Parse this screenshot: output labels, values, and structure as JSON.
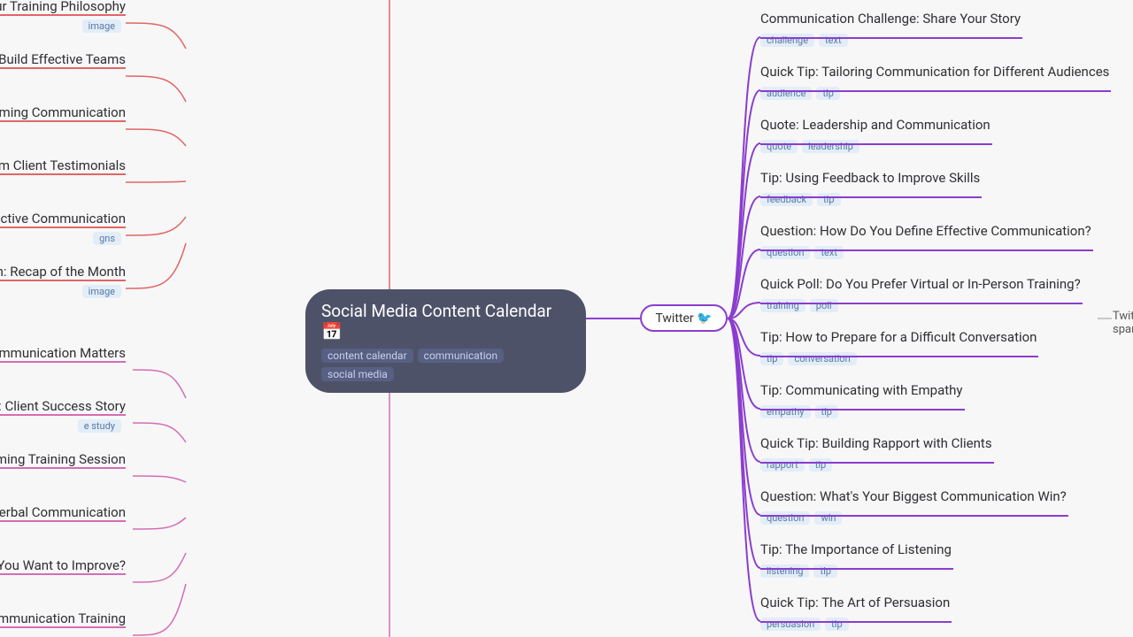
{
  "center": {
    "title": "Social Media Content Calendar 📅",
    "tags": [
      "content calendar",
      "communication",
      "social media"
    ]
  },
  "twitter_label": "Twitter 🐦",
  "right_items": [
    {
      "title": "Communication Challenge: Share Your Story",
      "tags": [
        "challenge",
        "text"
      ]
    },
    {
      "title": "Quick Tip: Tailoring Communication for Different Audiences",
      "tags": [
        "audience",
        "tip"
      ]
    },
    {
      "title": "Quote: Leadership and Communication",
      "tags": [
        "quote",
        "leadership"
      ]
    },
    {
      "title": "Tip: Using Feedback to Improve Skills",
      "tags": [
        "feedback",
        "tip"
      ]
    },
    {
      "title": "Question: How Do You Define Effective Communication?",
      "tags": [
        "question",
        "text"
      ]
    },
    {
      "title": "Quick Poll: Do You Prefer Virtual or In-Person Training?",
      "tags": [
        "training",
        "poll"
      ]
    },
    {
      "title": "Tip: How to Prepare for a Difficult Conversation",
      "tags": [
        "tip",
        "conversation"
      ]
    },
    {
      "title": "Tip: Communicating with Empathy",
      "tags": [
        "empathy",
        "tip"
      ]
    },
    {
      "title": "Quick Tip: Building Rapport with Clients",
      "tags": [
        "rapport",
        "tip"
      ]
    },
    {
      "title": "Question: What's Your Biggest Communication Win?",
      "tags": [
        "question",
        "win"
      ]
    },
    {
      "title": "Tip: The Importance of Listening",
      "tags": [
        "listening",
        "tip"
      ]
    },
    {
      "title": "Quick Tip: The Art of Persuasion",
      "tags": [
        "persuasion",
        "tip"
      ]
    }
  ],
  "left_items_red": [
    {
      "title": "ur Training Philosophy",
      "tags": [
        "image"
      ]
    },
    {
      "title": "o Build Effective Teams",
      "tags": []
    },
    {
      "title": "rming Communication",
      "tags": []
    },
    {
      "title": "om Client Testimonials",
      "tags": []
    },
    {
      "title": "ective Communication",
      "tags": [
        "gns"
      ]
    },
    {
      "title": "n: Recap of the Month",
      "tags": [
        "image"
      ]
    }
  ],
  "left_items_pink": [
    {
      "title": "Communication Matters",
      "tags": []
    },
    {
      "title": "dy: Client Success Story",
      "tags": [
        "e study"
      ]
    },
    {
      "title": "coming Training Session",
      "tags": []
    },
    {
      "title": "-Verbal Communication",
      "tags": []
    },
    {
      "title": "Do You Want to Improve?",
      "tags": []
    },
    {
      "title": "Communication Training",
      "tags": []
    }
  ],
  "far_right": [
    "Twit",
    "spar"
  ]
}
